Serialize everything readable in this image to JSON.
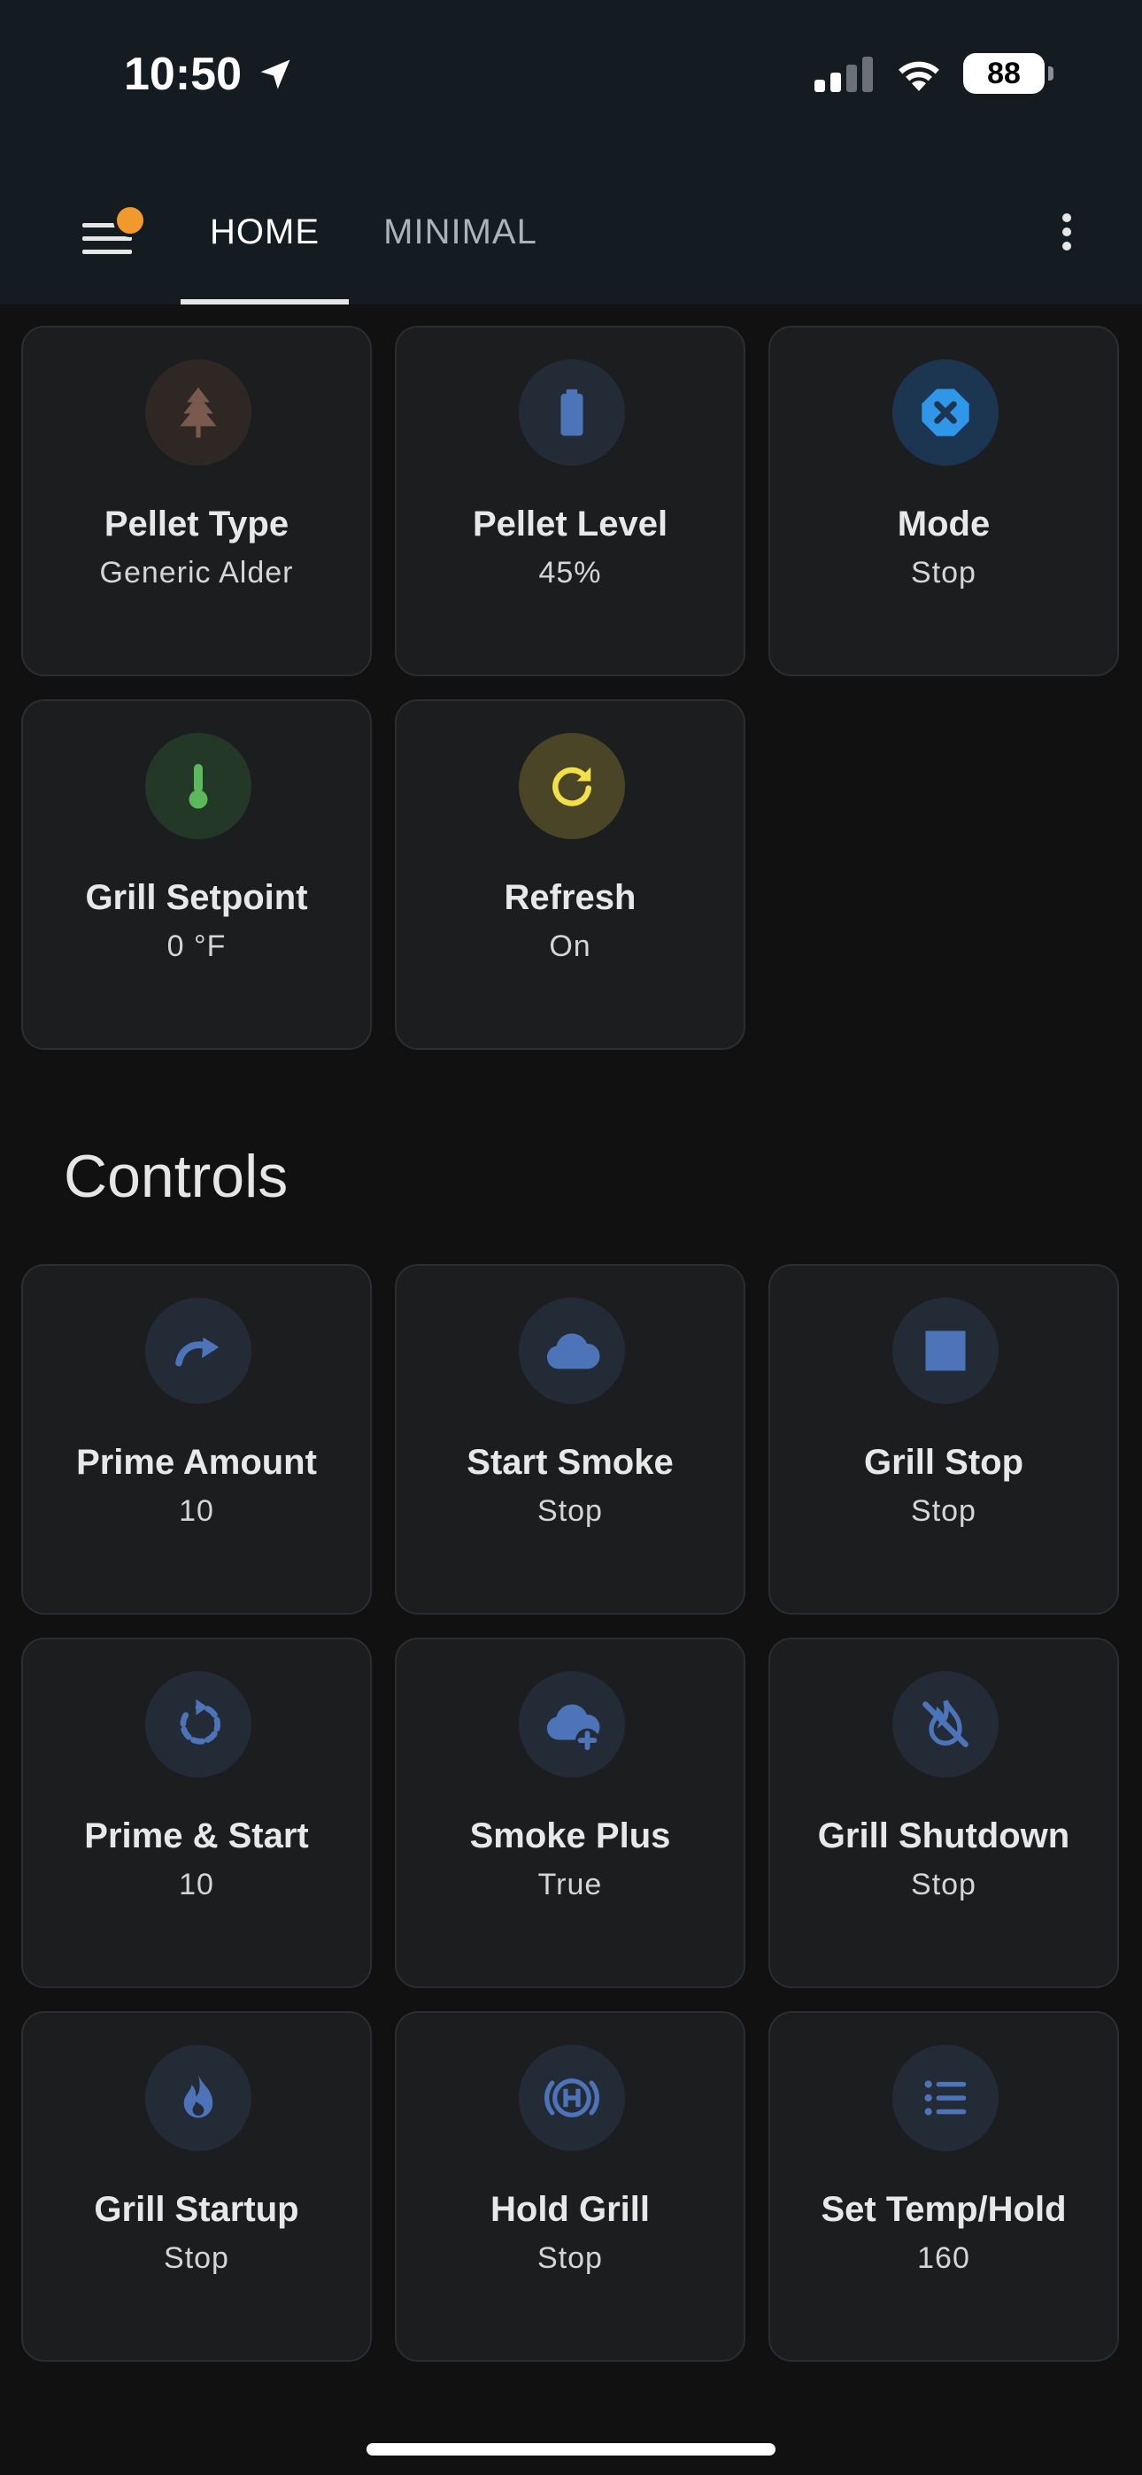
{
  "status_bar": {
    "time": "10:50",
    "battery": "88"
  },
  "appbar": {
    "tabs": [
      {
        "label": "HOME"
      },
      {
        "label": "MINIMAL"
      }
    ]
  },
  "entities": [
    {
      "title": "Pellet Type",
      "value": "Generic Alder",
      "icon": "pine-tree-icon",
      "icon_color": "#7a5a4c"
    },
    {
      "title": "Pellet Level",
      "value": "45%",
      "icon": "battery-icon",
      "icon_color": "#4d74b8"
    },
    {
      "title": "Mode",
      "value": "Stop",
      "icon": "close-octagon-icon",
      "icon_color": "#2f96e8"
    },
    {
      "title": "Grill Setpoint",
      "value": "0 °F",
      "icon": "thermometer-icon",
      "icon_color": "#5cb85c"
    },
    {
      "title": "Refresh",
      "value": "On",
      "icon": "refresh-icon",
      "icon_color": "#f2e04a"
    }
  ],
  "controls": {
    "section_title": "Controls",
    "items": [
      {
        "title": "Prime Amount",
        "value": "10",
        "icon": "redo-arrow-icon"
      },
      {
        "title": "Start Smoke",
        "value": "Stop",
        "icon": "cloud-icon"
      },
      {
        "title": "Grill Stop",
        "value": "Stop",
        "icon": "stop-square-icon"
      },
      {
        "title": "Prime & Start",
        "value": "10",
        "icon": "restart-icon"
      },
      {
        "title": "Smoke Plus",
        "value": "True",
        "icon": "cloud-plus-icon"
      },
      {
        "title": "Grill Shutdown",
        "value": "Stop",
        "icon": "fire-off-icon"
      },
      {
        "title": "Grill Startup",
        "value": "Stop",
        "icon": "fire-icon"
      },
      {
        "title": "Hold Grill",
        "value": "Stop",
        "icon": "hold-h-icon"
      },
      {
        "title": "Set Temp/Hold",
        "value": "160",
        "icon": "list-icon"
      }
    ]
  },
  "colors": {
    "control_icon": "#4d74b8",
    "control_icon_bg": "#232b36"
  }
}
